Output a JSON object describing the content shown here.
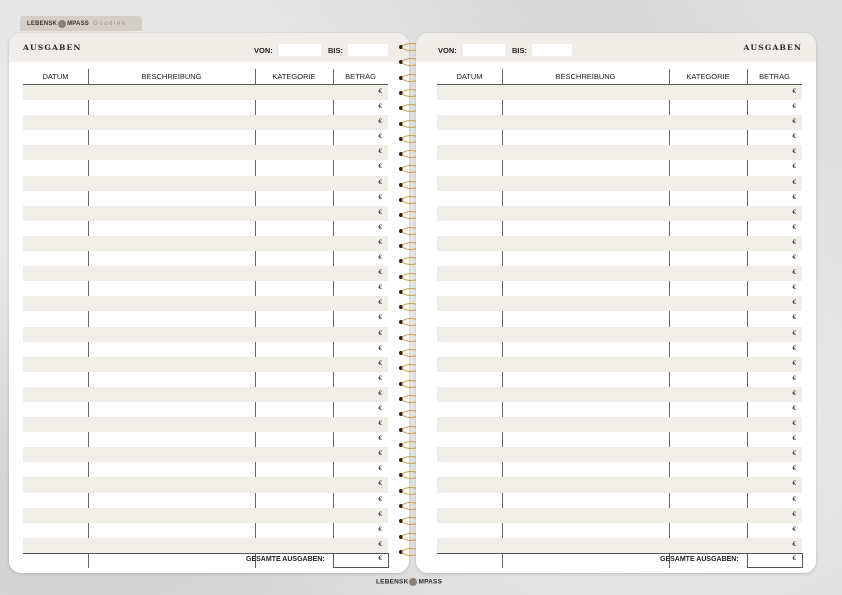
{
  "brand": {
    "name_part1": "LEBENSK",
    "name_part2": "MPASS",
    "suffix": "Goodies"
  },
  "left_page": {
    "title": "AUSGABEN",
    "from_label": "VON:",
    "to_label": "BIS:",
    "columns": [
      "DATUM",
      "BESCHREIBUNG",
      "KATEGORIE",
      "BETRAG"
    ],
    "currency": "€",
    "total_label": "GESAMTE AUSGABEN:",
    "row_count": 31
  },
  "right_page": {
    "title": "AUSGABEN",
    "from_label": "VON:",
    "to_label": "BIS:",
    "columns": [
      "DATUM",
      "BESCHREIBUNG",
      "KATEGORIE",
      "BETRAG"
    ],
    "currency": "€",
    "total_label": "GESAMTE AUSGABEN:",
    "row_count": 31
  },
  "footer": {
    "name_part1": "LEBENSK",
    "name_part2": "MPASS"
  },
  "colors": {
    "background": "#dedede",
    "header_band": "#f0ece8",
    "row_stripe": "#f1eeea",
    "spiral_gold": "#c9a24a",
    "brand_tab": "#d5cec6"
  }
}
